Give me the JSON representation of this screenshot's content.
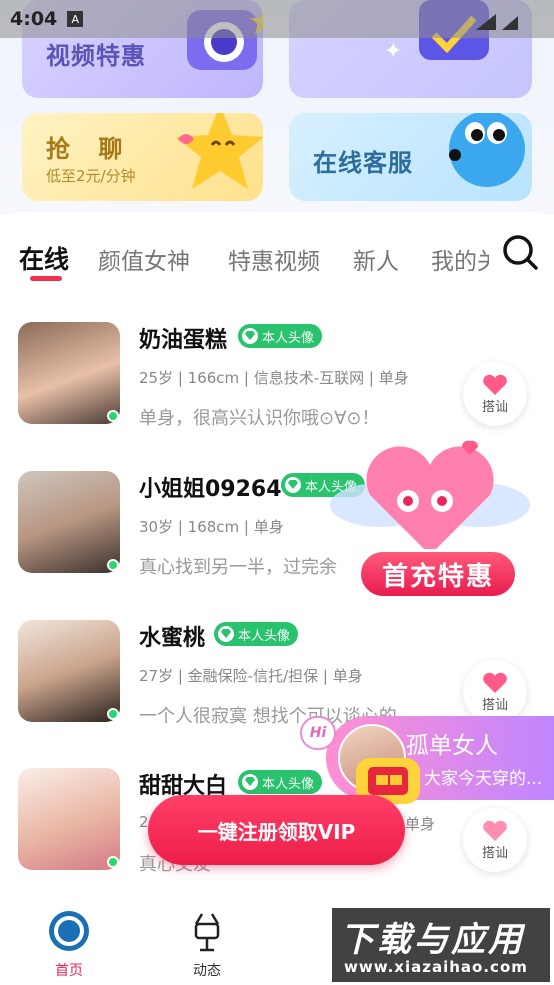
{
  "status_bar": {
    "time": "4:04",
    "notification_icon": "A"
  },
  "promo_cards": {
    "video": {
      "title": "视频特惠"
    },
    "chat": {
      "title": "抢 聊",
      "subtitle": "低至2元/分钟"
    },
    "service": {
      "title": "在线客服"
    }
  },
  "tabs": [
    {
      "label": "在线"
    },
    {
      "label": "颜值女神"
    },
    {
      "label": "特惠视频"
    },
    {
      "label": "新人"
    },
    {
      "label": "我的关"
    }
  ],
  "users": [
    {
      "name": "奶油蛋糕",
      "badge": "本人头像",
      "info": "25岁 | 166cm | 信息技术-互联网 | 单身",
      "bio": "单身，很高兴认识你哦⊙∀⊙！",
      "chat_label": "搭讪"
    },
    {
      "name": "小姐姐09264",
      "badge": "本人头像",
      "info": "30岁 | 168cm | 单身",
      "bio": "真心找到另一半，过完余",
      "chat_label": "搭讪"
    },
    {
      "name": "水蜜桃",
      "badge": "本人头像",
      "info": "27岁 | 金融保险-信托/担保 | 单身",
      "bio": "一个人很寂寞 想找个可以谈心的",
      "chat_label": "搭讪"
    },
    {
      "name": "甜甜大白",
      "badge": "本人头像",
      "info": "2",
      "info_tail": "单身",
      "bio": "真心交友",
      "chat_label": "搭讪"
    }
  ],
  "floating": {
    "first_charge": "首充特惠",
    "hi": "Hi",
    "lonely_title": "孤单女人",
    "lonely_sub": "大家今天穿的...",
    "register": "一键注册领取VIP"
  },
  "bottom_nav": [
    {
      "label": "首页",
      "icon": "home-icon"
    },
    {
      "label": "动态",
      "icon": "moments-icon"
    }
  ],
  "watermark": {
    "line1": "下载与应用",
    "line2": "www.xiazaihao.com"
  },
  "colors": {
    "accent": "#f0314c",
    "badge": "#29c26d",
    "online": "#27d86d"
  }
}
